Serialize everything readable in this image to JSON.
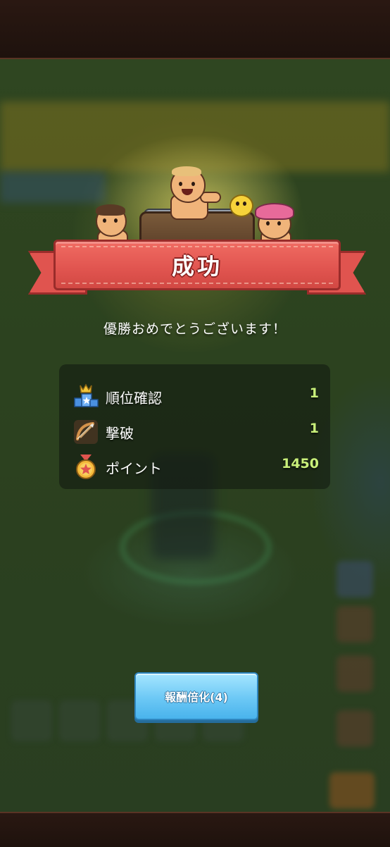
{
  "result": {
    "title": "成功",
    "message": "優勝おめでとうございます！"
  },
  "stats": [
    {
      "label": "順位確認",
      "value": "1",
      "icon": "crown-podium-icon"
    },
    {
      "label": "撃破",
      "value": "1",
      "icon": "bow-arrow-icon"
    },
    {
      "label": "ポイント",
      "value": "1450",
      "icon": "star-medal-icon"
    }
  ],
  "reward_button": {
    "label": "報酬倍化(4)"
  },
  "colors": {
    "ribbon": "#e0544f",
    "stat_value": "#c9f07a",
    "button": "#6cc8f5"
  }
}
